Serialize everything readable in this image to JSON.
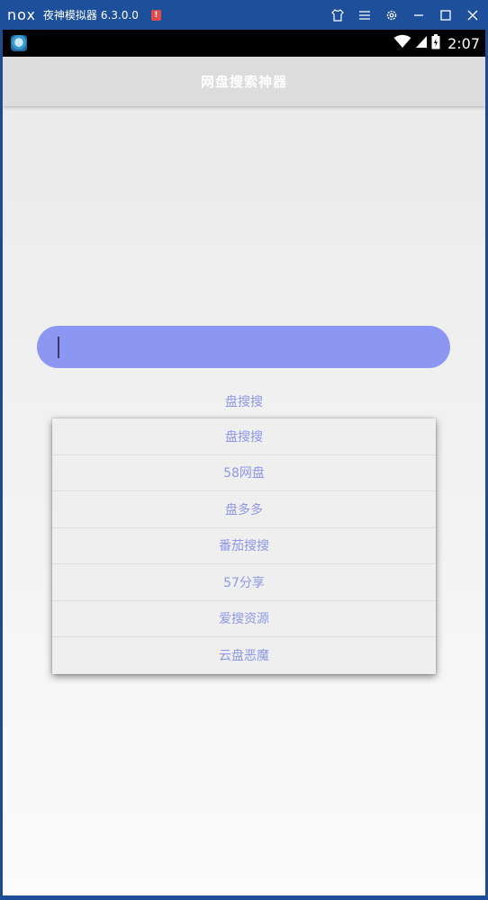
{
  "window": {
    "logo": "nox",
    "app_name": "夜神模拟器",
    "version": "6.3.0.0",
    "alert_badge": "!",
    "controls": [
      "shirt-icon",
      "menu-icon",
      "settings-icon",
      "minimize-icon",
      "maximize-icon",
      "close-icon"
    ]
  },
  "statusbar": {
    "time": "2:07",
    "icons": [
      "wifi-icon",
      "signal-icon",
      "battery-icon"
    ]
  },
  "appbar": {
    "title": "网盘搜索神器"
  },
  "search": {
    "value": "",
    "color": "#8c96f3"
  },
  "engine_selector": {
    "selected": "盘搜搜",
    "options": [
      "盘搜搜",
      "58网盘",
      "盘多多",
      "番茄搜搜",
      "57分享",
      "爱搜资源",
      "云盘恶魔"
    ]
  },
  "colors": {
    "accent": "#8c96f3",
    "text_accent": "#8e98e6",
    "window_frame": "#1d4f9a"
  }
}
